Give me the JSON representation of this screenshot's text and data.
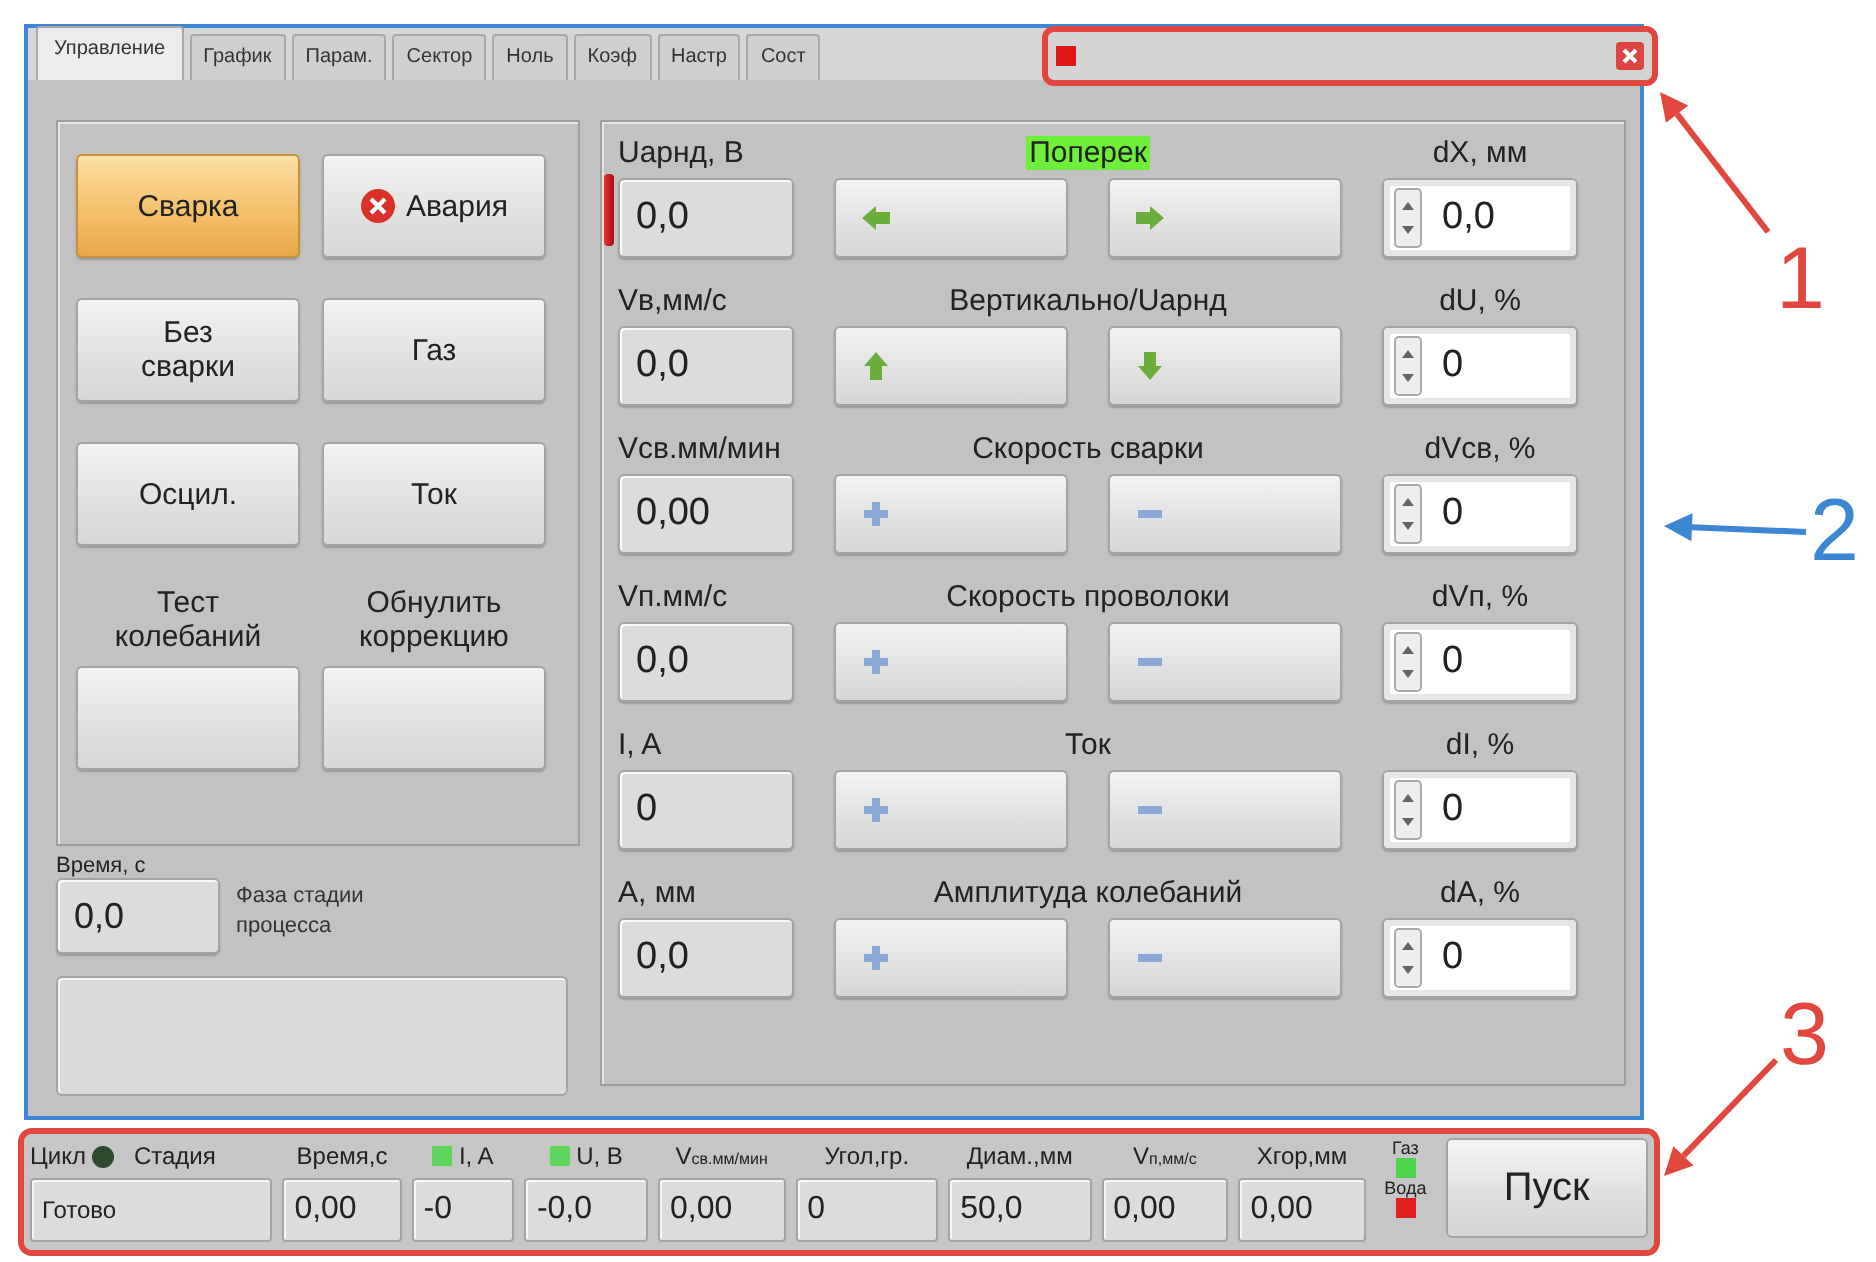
{
  "tabs": [
    {
      "label": "Управление",
      "selected": true
    },
    {
      "label": "График",
      "selected": false
    },
    {
      "label": "Парам.",
      "selected": false
    },
    {
      "label": "Сектор",
      "selected": false
    },
    {
      "label": "Ноль",
      "selected": false
    },
    {
      "label": "Коэф",
      "selected": false
    },
    {
      "label": "Настр",
      "selected": false
    },
    {
      "label": "Сост",
      "selected": false
    }
  ],
  "left_panel": {
    "buttons": [
      {
        "kind": "text",
        "label": "Сварка",
        "selected": true
      },
      {
        "kind": "alarm",
        "label": "Авария",
        "selected": false
      },
      {
        "kind": "text",
        "label": "Без\nсварки",
        "selected": false
      },
      {
        "kind": "text",
        "label": "Газ",
        "selected": false
      },
      {
        "kind": "text",
        "label": "Осцил.",
        "selected": false
      },
      {
        "kind": "text",
        "label": "Ток",
        "selected": false
      },
      {
        "kind": "captioned",
        "caption": "Тест\nколебаний",
        "selected": false
      },
      {
        "kind": "captioned",
        "caption": "Обнулить\nкоррекцию",
        "selected": false
      }
    ],
    "time": {
      "label": "Время, с",
      "value": "0,0"
    },
    "phase": {
      "label": "Фаза стадии\nпроцесса"
    }
  },
  "controls": [
    {
      "label": "Uарнд, В",
      "value": "0,0",
      "alarm": true,
      "title": "Поперек",
      "highlighted": true,
      "kind": "horizontal",
      "delta_label": "dX, мм",
      "delta_value": "0,0"
    },
    {
      "label": "Vв,мм/с",
      "value": "0,0",
      "alarm": false,
      "title": "Вертикально/Uарнд",
      "highlighted": false,
      "kind": "vertical",
      "delta_label": "dU, %",
      "delta_value": "0"
    },
    {
      "label": "Vсв.мм/мин",
      "value": "0,00",
      "alarm": false,
      "title": "Скорость сварки",
      "highlighted": false,
      "kind": "adjust",
      "delta_label": "dVсв, %",
      "delta_value": "0"
    },
    {
      "label": "Vп.мм/с",
      "value": "0,0",
      "alarm": false,
      "title": "Скорость проволоки",
      "highlighted": false,
      "kind": "adjust",
      "delta_label": "dVп, %",
      "delta_value": "0"
    },
    {
      "label": "I, A",
      "value": "0",
      "alarm": false,
      "title": "Ток",
      "highlighted": false,
      "kind": "adjust",
      "delta_label": "dI, %",
      "delta_value": "0"
    },
    {
      "label": "A, мм",
      "value": "0,0",
      "alarm": false,
      "title": "Амплитуда колебаний",
      "highlighted": false,
      "kind": "adjust",
      "delta_label": "dA, %",
      "delta_value": "0"
    }
  ],
  "status_bar": {
    "cells": [
      {
        "labels": [
          {
            "text": "Цикл",
            "kind": "dot",
            "color": "#2e4a2e"
          },
          {
            "text": "Стадия"
          }
        ],
        "value": "Готово"
      },
      {
        "labels": [
          {
            "text": "Время,с"
          }
        ],
        "value": "0,00"
      },
      {
        "labels": [
          {
            "text": "I, A",
            "kind": "square",
            "color": "#5ed65e"
          }
        ],
        "value": "-0"
      },
      {
        "labels": [
          {
            "text": "U, В",
            "kind": "square",
            "color": "#5ed65e"
          }
        ],
        "value": "-0,0"
      },
      {
        "labels": [
          {
            "text": "V$_{св.мм/мин}$"
          }
        ],
        "value": "0,00"
      },
      {
        "labels": [
          {
            "text": "Угол,гр."
          }
        ],
        "value": "0"
      },
      {
        "labels": [
          {
            "text": "Диам.,мм"
          }
        ],
        "value": "50,0"
      },
      {
        "labels": [
          {
            "text": "V$_{п,мм/с}$"
          }
        ],
        "value": "0,00"
      },
      {
        "labels": [
          {
            "text": "Хгор,мм"
          }
        ],
        "value": "0,00"
      }
    ],
    "indicators": [
      {
        "label": "Газ",
        "color": "#4cd64c"
      },
      {
        "label": "Вода",
        "color": "#e02020"
      }
    ],
    "start_button": "Пуск"
  },
  "callouts": [
    {
      "label": "1",
      "color": "#e2473d",
      "framed": true
    },
    {
      "label": "2",
      "color": "#3d86d4",
      "framed": true
    },
    {
      "label": "3",
      "color": "#e2473d",
      "framed": true
    }
  ]
}
